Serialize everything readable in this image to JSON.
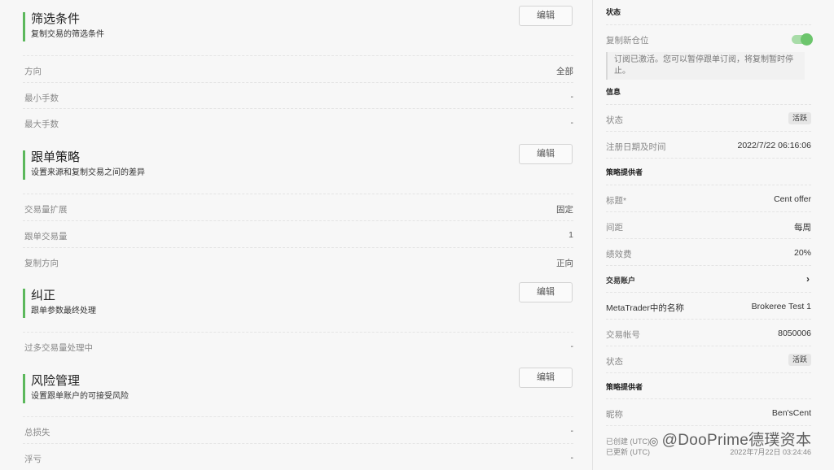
{
  "left": {
    "sections": [
      {
        "title": "筛选条件",
        "subtitle": "复制交易的筛选条件",
        "edit_label": "编辑",
        "rows": [
          {
            "key": "方向",
            "value": "全部"
          },
          {
            "key": "最小手数",
            "value": "-"
          },
          {
            "key": "最大手数",
            "value": "-"
          }
        ]
      },
      {
        "title": "跟单策略",
        "subtitle": "设置来源和复制交易之间的差异",
        "edit_label": "编辑",
        "rows": [
          {
            "key": "交易量扩展",
            "value": "固定"
          },
          {
            "key": "跟单交易量",
            "value": "1"
          },
          {
            "key": "复制方向",
            "value": "正向"
          }
        ]
      },
      {
        "title": "纠正",
        "subtitle": "跟单参数最终处理",
        "edit_label": "编辑",
        "rows": [
          {
            "key": "过多交易量处理中",
            "value": "-"
          }
        ]
      },
      {
        "title": "风险管理",
        "subtitle": "设置跟单账户的可接受风险",
        "edit_label": "编辑",
        "rows": [
          {
            "key": "总损失",
            "value": "-"
          },
          {
            "key": "浮亏",
            "value": "-"
          }
        ]
      }
    ]
  },
  "right": {
    "status_header": "状态",
    "copy_new_positions_label": "复制新仓位",
    "copy_new_positions_on": true,
    "notice": "订阅已激活。您可以暂停跟单订阅，将复制暂时停止。",
    "info_header": "信息",
    "info_status_label": "状态",
    "info_status_badge": "活跃",
    "registered_label": "注册日期及时间",
    "registered_value": "2022/7/22 06:16:06",
    "provider_header": "策略提供者",
    "title_label": "标题*",
    "title_value": "Cent offer",
    "interval_label": "间距",
    "interval_value": "每周",
    "fee_label": "绩效费",
    "fee_value": "20%",
    "account_header": "交易账户",
    "mt_name_label": "MetaTrader中的名称",
    "mt_name_value": "Brokeree Test 1",
    "account_no_label": "交易帐号",
    "account_no_value": "8050006",
    "account_status_label": "状态",
    "account_status_badge": "活跃",
    "provider2_header": "策略提供者",
    "nickname_label": "昵称",
    "nickname_value": "Ben'sCent",
    "created_label": "已创建 (UTC)",
    "updated_label": "已更新 (UTC)",
    "updated_value": "2022年7月22日 03:24:46"
  },
  "watermark": "@DooPrime德璞资本"
}
